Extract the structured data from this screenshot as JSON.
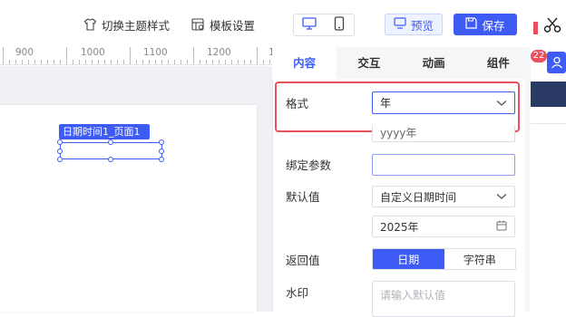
{
  "toolbar": {
    "switch_theme": "切换主题样式",
    "template_settings": "模板设置",
    "preview": "预览",
    "save": "保存"
  },
  "ruler": {
    "labels": [
      "900",
      "1000",
      "1100",
      "1200",
      "1"
    ]
  },
  "canvas": {
    "component_tag": "日期时间1_页面1"
  },
  "panel": {
    "tabs": [
      "内容",
      "交互",
      "动画",
      "组件"
    ],
    "active_tab": "内容",
    "format": {
      "label": "格式",
      "value": "年",
      "preview": "yyyy年"
    },
    "bind_param": {
      "label": "绑定参数",
      "value": ""
    },
    "default_value": {
      "label": "默认值",
      "value": "自定义日期时间",
      "date": "2025年"
    },
    "return_value": {
      "label": "返回值",
      "options": [
        "日期",
        "字符串"
      ],
      "selected": "日期"
    },
    "watermark": {
      "label": "水印",
      "placeholder": "请输入默认值"
    }
  },
  "edge": {
    "badge": "22"
  },
  "colors": {
    "accent": "#3e5bf5",
    "highlight": "#e8505b",
    "dark_bar": "#2a3a66"
  }
}
